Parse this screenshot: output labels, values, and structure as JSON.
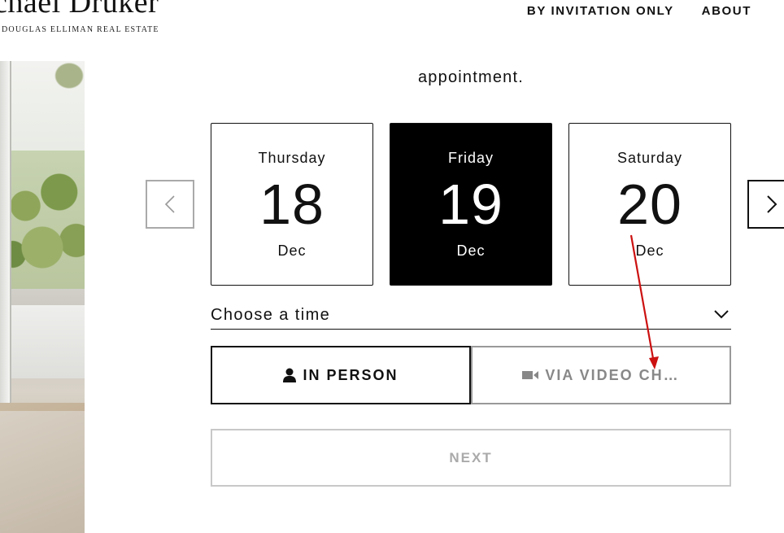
{
  "header": {
    "brand_name": "chael Druker",
    "brand_subtitle": "DOUGLAS ELLIMAN REAL ESTATE",
    "nav": [
      {
        "label": "BY INVITATION ONLY"
      },
      {
        "label": "ABOUT"
      }
    ]
  },
  "appointment": {
    "intro_text": "appointment.",
    "days": [
      {
        "weekday": "Thursday",
        "day": "18",
        "month": "Dec",
        "selected": false
      },
      {
        "weekday": "Friday",
        "day": "19",
        "month": "Dec",
        "selected": true
      },
      {
        "weekday": "Saturday",
        "day": "20",
        "month": "Dec",
        "selected": false
      }
    ],
    "time_select_label": "Choose a time",
    "modes": {
      "in_person": "IN PERSON",
      "video": "VIA VIDEO CH…"
    },
    "next_label": "NEXT"
  },
  "icons": {
    "prev": "chevron-left-icon",
    "next": "chevron-right-icon",
    "dropdown": "chevron-down-icon",
    "person": "person-icon",
    "video": "video-camera-icon"
  },
  "colors": {
    "selected_bg": "#000000",
    "annotation_arrow": "#cc1111",
    "disabled_text": "#aaaaaa"
  }
}
